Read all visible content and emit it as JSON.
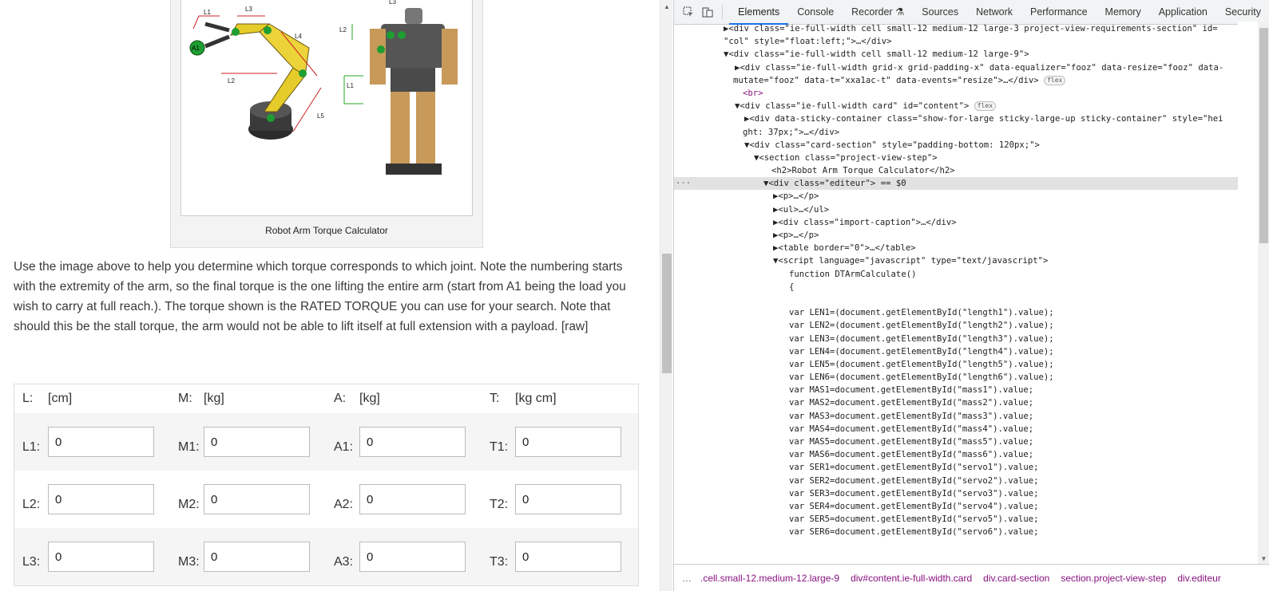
{
  "figure": {
    "caption": "Robot Arm Torque Calculator"
  },
  "intro_text": "Use the image above to help you determine which torque corresponds to which joint. Note the numbering starts with the extremity of the arm, so the final torque is the one lifting the entire arm (start from A1 being the load you wish to carry at full reach.). The torque shown is the RATED TORQUE you can use for your search. Note that should this be the stall torque, the arm would not be able to lift itself at full extension with a payload. [raw]",
  "calculator": {
    "headers": [
      {
        "label": "L:",
        "unit": "[cm]"
      },
      {
        "label": "M:",
        "unit": "[kg]"
      },
      {
        "label": "A:",
        "unit": "[kg]"
      },
      {
        "label": "T:",
        "unit": "[kg cm]"
      }
    ],
    "rows": [
      [
        {
          "label": "L1:",
          "value": "0"
        },
        {
          "label": "M1:",
          "value": "0"
        },
        {
          "label": "A1:",
          "value": "0"
        },
        {
          "label": "T1:",
          "value": "0"
        }
      ],
      [
        {
          "label": "L2:",
          "value": "0"
        },
        {
          "label": "M2:",
          "value": "0"
        },
        {
          "label": "A2:",
          "value": "0"
        },
        {
          "label": "T2:",
          "value": "0"
        }
      ],
      [
        {
          "label": "L3:",
          "value": "0"
        },
        {
          "label": "M3:",
          "value": "0"
        },
        {
          "label": "A3:",
          "value": "0"
        },
        {
          "label": "T3:",
          "value": "0"
        }
      ]
    ]
  },
  "devtools": {
    "tabs": [
      "Elements",
      "Console",
      "Recorder",
      "Sources",
      "Network",
      "Performance",
      "Memory",
      "Application",
      "Security"
    ],
    "active_tab": "Elements",
    "icons": [
      "inspect-icon",
      "device-toggle-icon"
    ],
    "dom_lines": [
      "▶<div class=\"ie-full-width cell small-12 medium-12 large-3 project-view-requirements-section\" id=",
      "\"col\" style=\"float:left;\">…</div>",
      "▼<div class=\"ie-full-width cell small-12 medium-12 large-9\">",
      "▶<div class=\"ie-full-width grid-x grid-padding-x\" data-equalizer=\"fooz\" data-resize=\"fooz\" data-",
      "mutate=\"fooz\" data-t=\"xxa1ac-t\" data-events=\"resize\">…</div>",
      "<br>",
      "▼<div class=\"ie-full-width card\" id=\"content\">",
      "▶<div data-sticky-container class=\"show-for-large sticky-large-up sticky-container\" style=\"hei",
      "ght: 37px;\">…</div>",
      "▼<div class=\"card-section\" style=\"padding-bottom: 120px;\">",
      "▼<section class=\"project-view-step\">",
      "<h2>Robot Arm Torque Calculator</h2>",
      "▼<div class=\"editeur\"> == $0",
      "▶<p>…</p>",
      "▶<ul>…</ul>",
      "▶<div class=\"import-caption\">…</div>",
      "▶<p>…</p>",
      "▶<table border=\"0\">…</table>",
      "▼<script language=\"javascript\" type=\"text/javascript\">",
      "function DTArmCalculate()",
      "{",
      "",
      "var LEN1=(document.getElementById(\"length1\").value);",
      "var LEN2=(document.getElementById(\"length2\").value);",
      "var LEN3=(document.getElementById(\"length3\").value);",
      "var LEN4=(document.getElementById(\"length4\").value);",
      "var LEN5=(document.getElementById(\"length5\").value);",
      "var LEN6=(document.getElementById(\"length6\").value);",
      "var MAS1=document.getElementById(\"mass1\").value;",
      "var MAS2=document.getElementById(\"mass2\").value;",
      "var MAS3=document.getElementById(\"mass3\").value;",
      "var MAS4=document.getElementById(\"mass4\").value;",
      "var MAS5=document.getElementById(\"mass5\").value;",
      "var MAS6=document.getElementById(\"mass6\").value;",
      "var SER1=document.getElementById(\"servo1\").value;",
      "var SER2=document.getElementById(\"servo2\").value;",
      "var SER3=document.getElementById(\"servo3\").value;",
      "var SER4=document.getElementById(\"servo4\").value;",
      "var SER5=document.getElementById(\"servo5\").value;",
      "var SER6=document.getElementById(\"servo6\").value;"
    ],
    "badge_flex": "flex",
    "breadcrumbs": [
      "…",
      ".cell.small-12.medium-12.large-9",
      "div#content.ie-full-width.card",
      "div.card-section",
      "section.project-view-step",
      "div.editeur"
    ]
  },
  "figure_labels": [
    "L1",
    "L3",
    "L4",
    "L2",
    "L5",
    "A1",
    "L3",
    "L2",
    "L1"
  ]
}
